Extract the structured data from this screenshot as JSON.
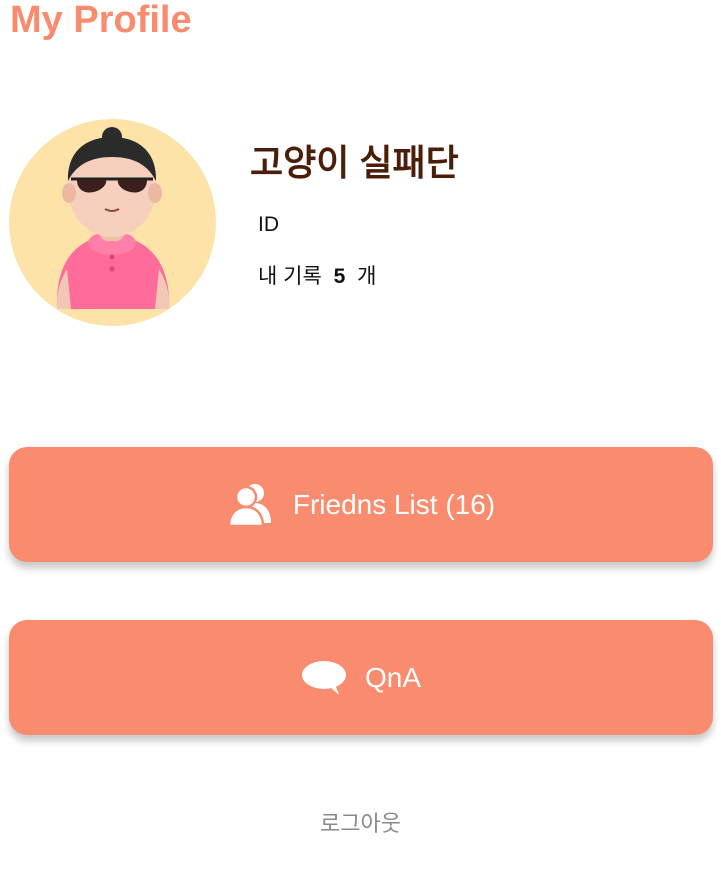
{
  "header": {
    "title": "My Profile"
  },
  "profile": {
    "avatar_icon": "cartoon-avatar-with-sunglasses",
    "name": "고양이 실패단",
    "id_label": "ID",
    "record_prefix": "내 기록",
    "record_count": "5",
    "record_suffix": "개"
  },
  "actions": {
    "friends": {
      "icon": "users-icon",
      "label": "Friedns List (16)"
    },
    "qna": {
      "icon": "chat-bubble-icon",
      "label": "QnA"
    }
  },
  "footer": {
    "logout_label": "로그아웃"
  },
  "colors": {
    "accent": "#F98C6E",
    "title_text": "#F98C6E",
    "name_text": "#4A1E08",
    "avatar_bg": "#FDE3A8",
    "button_text": "#FFFFFF",
    "logout_text": "#8A8A8A"
  }
}
